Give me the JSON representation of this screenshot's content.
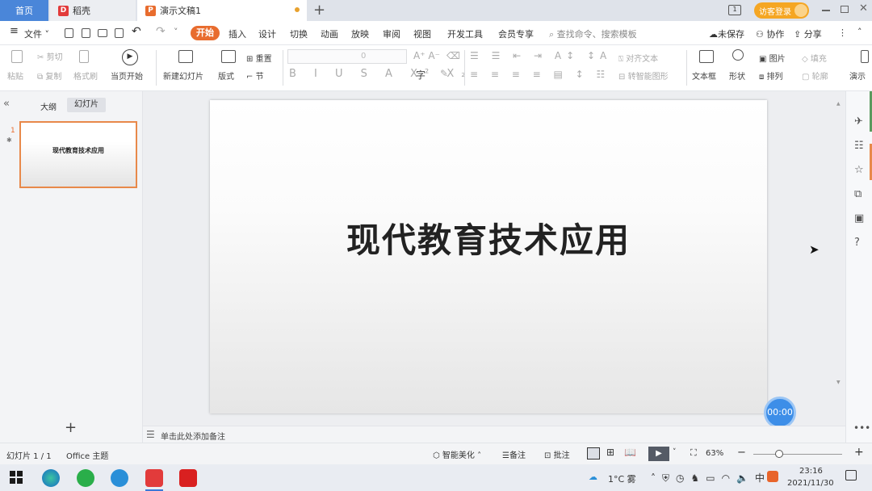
{
  "tabs": {
    "home": "首页",
    "daoke": "稻壳",
    "doc": "演示文稿1"
  },
  "titlebar": {
    "login": "访客登录"
  },
  "menu": {
    "file": "文件",
    "start": "开始",
    "insert": "插入",
    "design": "设计",
    "switch": "切换",
    "animation": "动画",
    "slideshow": "放映",
    "review": "审阅",
    "view": "视图",
    "dev": "开发工具",
    "member": "会员专享",
    "search": "查找命令、搜索模板",
    "unsaved": "未保存",
    "collab": "协作",
    "share": "分享"
  },
  "ribbon": {
    "paste": "粘贴",
    "cut": "剪切",
    "copy": "复制",
    "format_painter": "格式刷",
    "from_current": "当页开始",
    "new_slide": "新建幻灯片",
    "layout": "版式",
    "reset": "重置",
    "section": "节",
    "font_size": "0",
    "align_text": "对齐文本",
    "smartart": "转智能图形",
    "textbox": "文本框",
    "shape": "形状",
    "picture": "图片",
    "arrange": "排列",
    "fill": "填充",
    "outline": "轮廓",
    "present": "演示"
  },
  "left": {
    "outline_tab": "大纲",
    "slides_tab": "幻灯片",
    "thumb_num": "1",
    "thumb_title": "现代教育技术应用",
    "add": "+"
  },
  "slide": {
    "title": "现代教育技术应用"
  },
  "notes": {
    "placeholder": "单击此处添加备注"
  },
  "timer": "00:00",
  "status": {
    "slide_count": "幻灯片 1 / 1",
    "theme": "Office 主题",
    "beautify": "智能美化",
    "notes": "备注",
    "comment": "批注",
    "zoom": "63%"
  },
  "taskbar": {
    "temp": "1°C 雾",
    "time": "23:16",
    "date": "2021/11/30"
  }
}
